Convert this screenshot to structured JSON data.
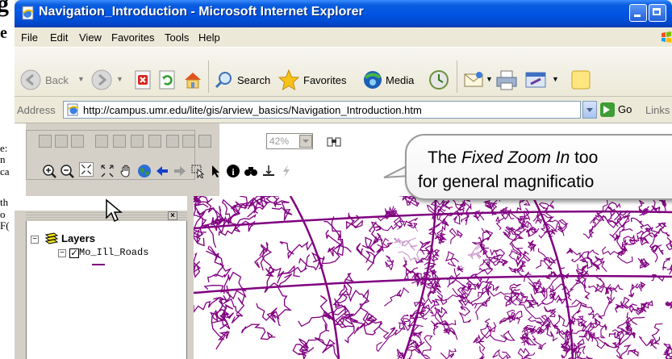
{
  "background_doc": {
    "heading_fragment": "g",
    "bold_fragment": "e",
    "line_fragments": [
      "e:",
      "n",
      "ca",
      "th",
      "o",
      "F("
    ]
  },
  "window": {
    "title": "Navigation_Introduction - Microsoft Internet Explorer"
  },
  "menubar": {
    "items": [
      "File",
      "Edit",
      "View",
      "Favorites",
      "Tools",
      "Help"
    ]
  },
  "toolbar": {
    "back_label": "Back",
    "search_label": "Search",
    "favorites_label": "Favorites",
    "media_label": "Media"
  },
  "address_bar": {
    "label": "Address",
    "url": "http://campus.umr.edu/lite/gis/arview_basics/Navigation_Introduction.htm",
    "go_label": "Go",
    "links_label": "Links"
  },
  "viewer": {
    "zoom_value": "42%",
    "toc": {
      "layers_label": "Layers",
      "layer_name": "Mo_Ill_Roads"
    },
    "map_line_color": "#800080"
  },
  "callout": {
    "line1_pre": "The ",
    "line1_em": "Fixed Zoom In",
    "line1_post": " too",
    "line2": "for general magnificatio"
  }
}
